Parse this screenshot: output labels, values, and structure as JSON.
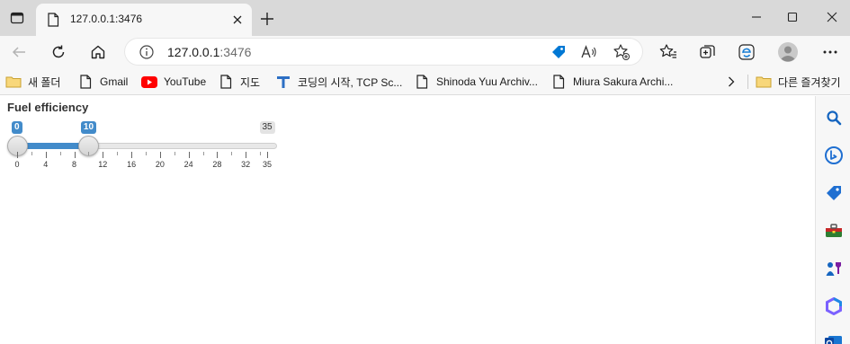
{
  "browser": {
    "tab": {
      "title": "127.0.0.1:3476"
    },
    "address": {
      "host": "127.0.0.1",
      "port": ":3476"
    },
    "favorites": [
      {
        "label": "새 폴더",
        "icon": "folder-icon"
      },
      {
        "label": "Gmail",
        "icon": "page-icon"
      },
      {
        "label": "YouTube",
        "icon": "youtube-icon"
      },
      {
        "label": "지도",
        "icon": "page-icon"
      },
      {
        "label": "코딩의 시작, TCP Sc...",
        "icon": "t-logo-icon"
      },
      {
        "label": "Shinoda Yuu Archiv...",
        "icon": "page-icon"
      },
      {
        "label": "Miura Sakura Archi...",
        "icon": "page-icon"
      }
    ],
    "other_favorites": {
      "label": "다른 즐겨찾기",
      "icon": "folder-icon"
    },
    "colors": {
      "accent": "#0078d4",
      "slider_blue": "#428bca"
    }
  },
  "slider": {
    "label": "Fuel efficiency",
    "from": 0,
    "to": 10,
    "min": 0,
    "max": 35,
    "from_label": "0",
    "to_label": "10",
    "max_label": "35",
    "tick_labels": [
      "0",
      "4",
      "8",
      "12",
      "16",
      "20",
      "24",
      "28",
      "32",
      "35"
    ]
  }
}
